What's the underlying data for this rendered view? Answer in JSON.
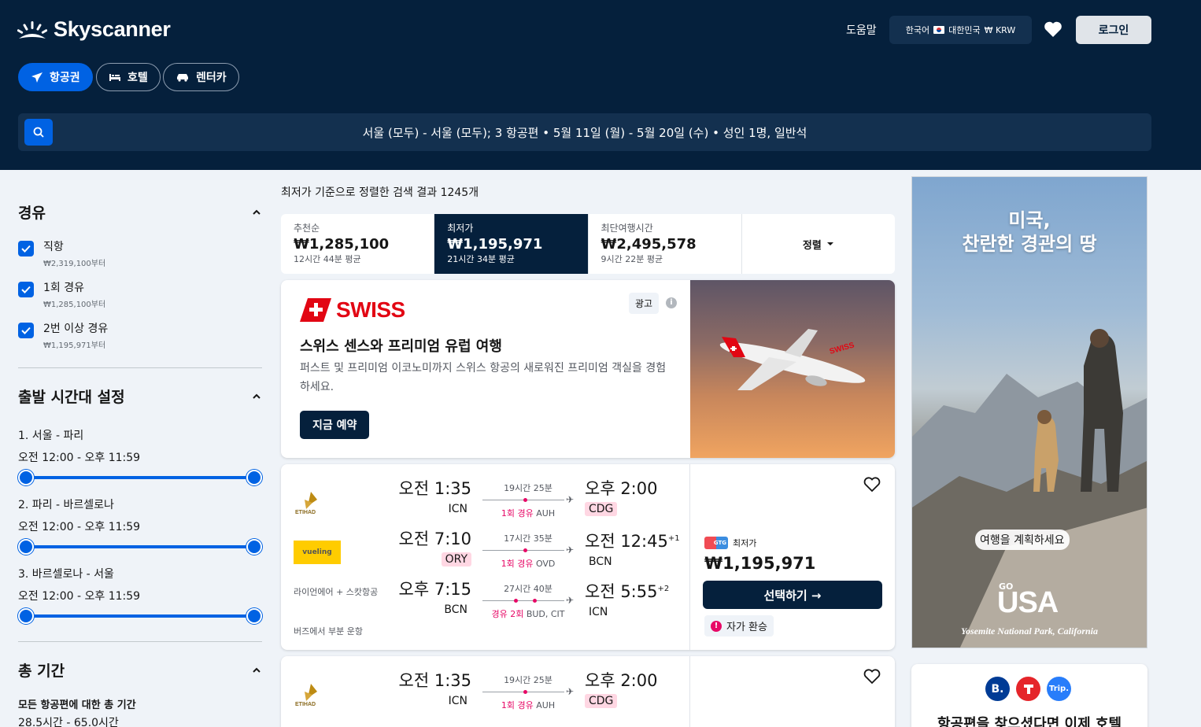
{
  "header": {
    "brand": "Skyscanner",
    "help": "도움말",
    "locale": {
      "lang": "한국어",
      "country": "대한민국",
      "currency": "₩ KRW"
    },
    "login": "로그인",
    "tabs": [
      {
        "label": "항공권",
        "icon": "plane-icon",
        "active": true
      },
      {
        "label": "호텔",
        "icon": "bed-icon",
        "active": false
      },
      {
        "label": "렌터카",
        "icon": "car-icon",
        "active": false
      }
    ],
    "search_summary": "서울 (모두) - 서울 (모두); 3 항공편  •  5월 11일 (월) - 5월 20일 (수)  •  성인 1명, 일반석"
  },
  "sidebar": {
    "stops": {
      "title": "경유",
      "options": [
        {
          "label": "직항",
          "sub": "₩2,319,100부터",
          "checked": true
        },
        {
          "label": "1회 경유",
          "sub": "₩1,285,100부터",
          "checked": true
        },
        {
          "label": "2번 이상 경유",
          "sub": "₩1,195,971부터",
          "checked": true
        }
      ]
    },
    "times": {
      "title": "출발 시간대 설정",
      "ranges": [
        {
          "route": "1. 서울 - 파리",
          "range": "오전 12:00 - 오후 11:59"
        },
        {
          "route": "2. 파리 - 바르셀로나",
          "range": "오전 12:00 - 오후 11:59"
        },
        {
          "route": "3. 바르셀로나 - 서울",
          "range": "오전 12:00 - 오후 11:59"
        }
      ]
    },
    "duration": {
      "title": "총 기간",
      "subtitle": "모든 항공편에 대한 총 기간",
      "range": "28.5시간 - 65.0시간"
    }
  },
  "results": {
    "heading": "최저가 기준으로 정렬한 검색 결과 1245개",
    "sort_tabs": [
      {
        "name": "추천순",
        "price": "₩1,285,100",
        "sub": "12시간 44분 평균",
        "active": false
      },
      {
        "name": "최저가",
        "price": "₩1,195,971",
        "sub": "21시간 34분 평균",
        "active": true
      },
      {
        "name": "최단여행시간",
        "price": "₩2,495,578",
        "sub": "9시간 22분 평균",
        "active": false
      }
    ],
    "sort_label": "정렬"
  },
  "ad": {
    "brand": "SWISS",
    "badge": "광고",
    "title": "스위스 센스와 프리미엄 유럽 여행",
    "desc": "퍼스트 및 프리미엄 이코노미까지 스위스 항공의 새로워진 프리미엄 객실을 경험하세요.",
    "cta": "지금 예약"
  },
  "flights": [
    {
      "legs": [
        {
          "dep_time": "오전 1:35",
          "dep_code": "ICN",
          "dep_warn": false,
          "duration": "19시간 25분",
          "stops_label": "1회 경유",
          "stops_via": "AUH",
          "arr_time": "오후 2:00",
          "arr_plus": "",
          "arr_code": "CDG",
          "arr_warn": true
        },
        {
          "dep_time": "오전 7:10",
          "dep_code": "ORY",
          "dep_warn": true,
          "duration": "17시간 35분",
          "stops_label": "1회 경유",
          "stops_via": "OVD",
          "arr_time": "오전 12:45",
          "arr_plus": "+1",
          "arr_code": "BCN",
          "arr_warn": false
        },
        {
          "dep_time": "오후 7:15",
          "dep_code": "BCN",
          "dep_warn": false,
          "duration": "27시간 40분",
          "stops_label": "경유 2회",
          "stops_via": "BUD, CIT",
          "arr_time": "오전 5:55",
          "arr_plus": "+2",
          "arr_code": "ICN",
          "arr_warn": false
        }
      ],
      "airlines": {
        "leg1": "ETIHAD",
        "leg2": "vueling",
        "leg3": "라이언에어 + 스캇항공"
      },
      "operated": "버즈에서 부분 운항",
      "provider_label": "최저가",
      "provider_badge": "GTG",
      "price": "₩1,195,971",
      "select": "선택하기 →",
      "self_transfer": "자가 환승"
    },
    {
      "legs": [
        {
          "dep_time": "오전 1:35",
          "dep_code": "ICN",
          "dep_warn": false,
          "duration": "19시간 25분",
          "stops_label": "1회 경유",
          "stops_via": "AUH",
          "arr_time": "오후 2:00",
          "arr_plus": "",
          "arr_code": "CDG",
          "arr_warn": true
        }
      ],
      "airlines": {
        "leg1": "ETIHAD"
      }
    }
  ],
  "right_ad": {
    "title_line1": "미국,",
    "title_line2": "찬란한 경관의 땅",
    "pill": "여행을 계획하세요",
    "go": "GO",
    "usa": "USA",
    "caption": "Yosemite National Park, California"
  },
  "hotel_promo": {
    "icons": [
      {
        "label": "B.",
        "color": "#003b95"
      },
      {
        "label": "",
        "color": "#e5252a"
      },
      {
        "label": "Trip.",
        "color": "#287dfa"
      }
    ],
    "text": "항공편을 찾으셨다면 이제 호텔"
  },
  "colors": {
    "navy": "#05203c",
    "brand_blue": "#0062e3",
    "accent_pink": "#e70866"
  }
}
